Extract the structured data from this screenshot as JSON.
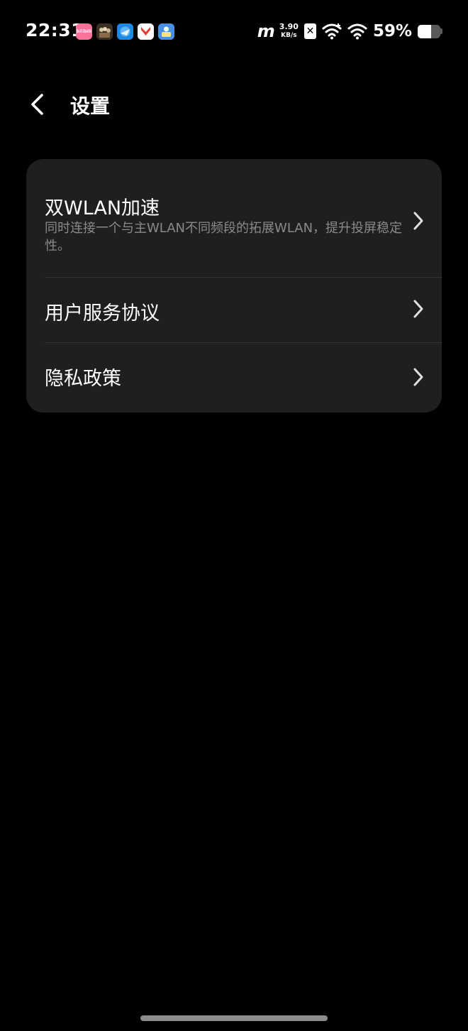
{
  "status_bar": {
    "time": "22:31",
    "notification_icons": [
      {
        "name": "bilibili-app-icon",
        "label": "bilibili",
        "color": "#fb7299"
      },
      {
        "name": "game-app-icon",
        "label": "",
        "color": "#6b5a3e"
      },
      {
        "name": "browser-app-icon",
        "label": "",
        "color": "#1e88e5"
      },
      {
        "name": "yandex-app-icon",
        "label": "",
        "color": "#ffffff"
      },
      {
        "name": "files-app-icon",
        "label": "",
        "color": "#4a90e2"
      }
    ],
    "signal_label": "m",
    "net_speed_value": "3.90",
    "net_speed_unit": "KB/s",
    "sim_label": "✕",
    "battery_percent": "59%",
    "battery_level": 0.59
  },
  "header": {
    "back_icon": "chevron-left-icon",
    "title": "设置"
  },
  "settings": {
    "items": [
      {
        "title": "双WLAN加速",
        "description": "同时连接一个与主WLAN不同频段的拓展WLAN，提升投屏稳定性。",
        "icon": "chevron-right-icon"
      },
      {
        "title": "用户服务协议",
        "icon": "chevron-right-icon"
      },
      {
        "title": "隐私政策",
        "icon": "chevron-right-icon"
      }
    ]
  },
  "colors": {
    "background": "#000000",
    "card": "#1f1f1f",
    "divider": "#333333",
    "title_text": "#ffffff",
    "secondary_text": "#8a8a8a"
  }
}
